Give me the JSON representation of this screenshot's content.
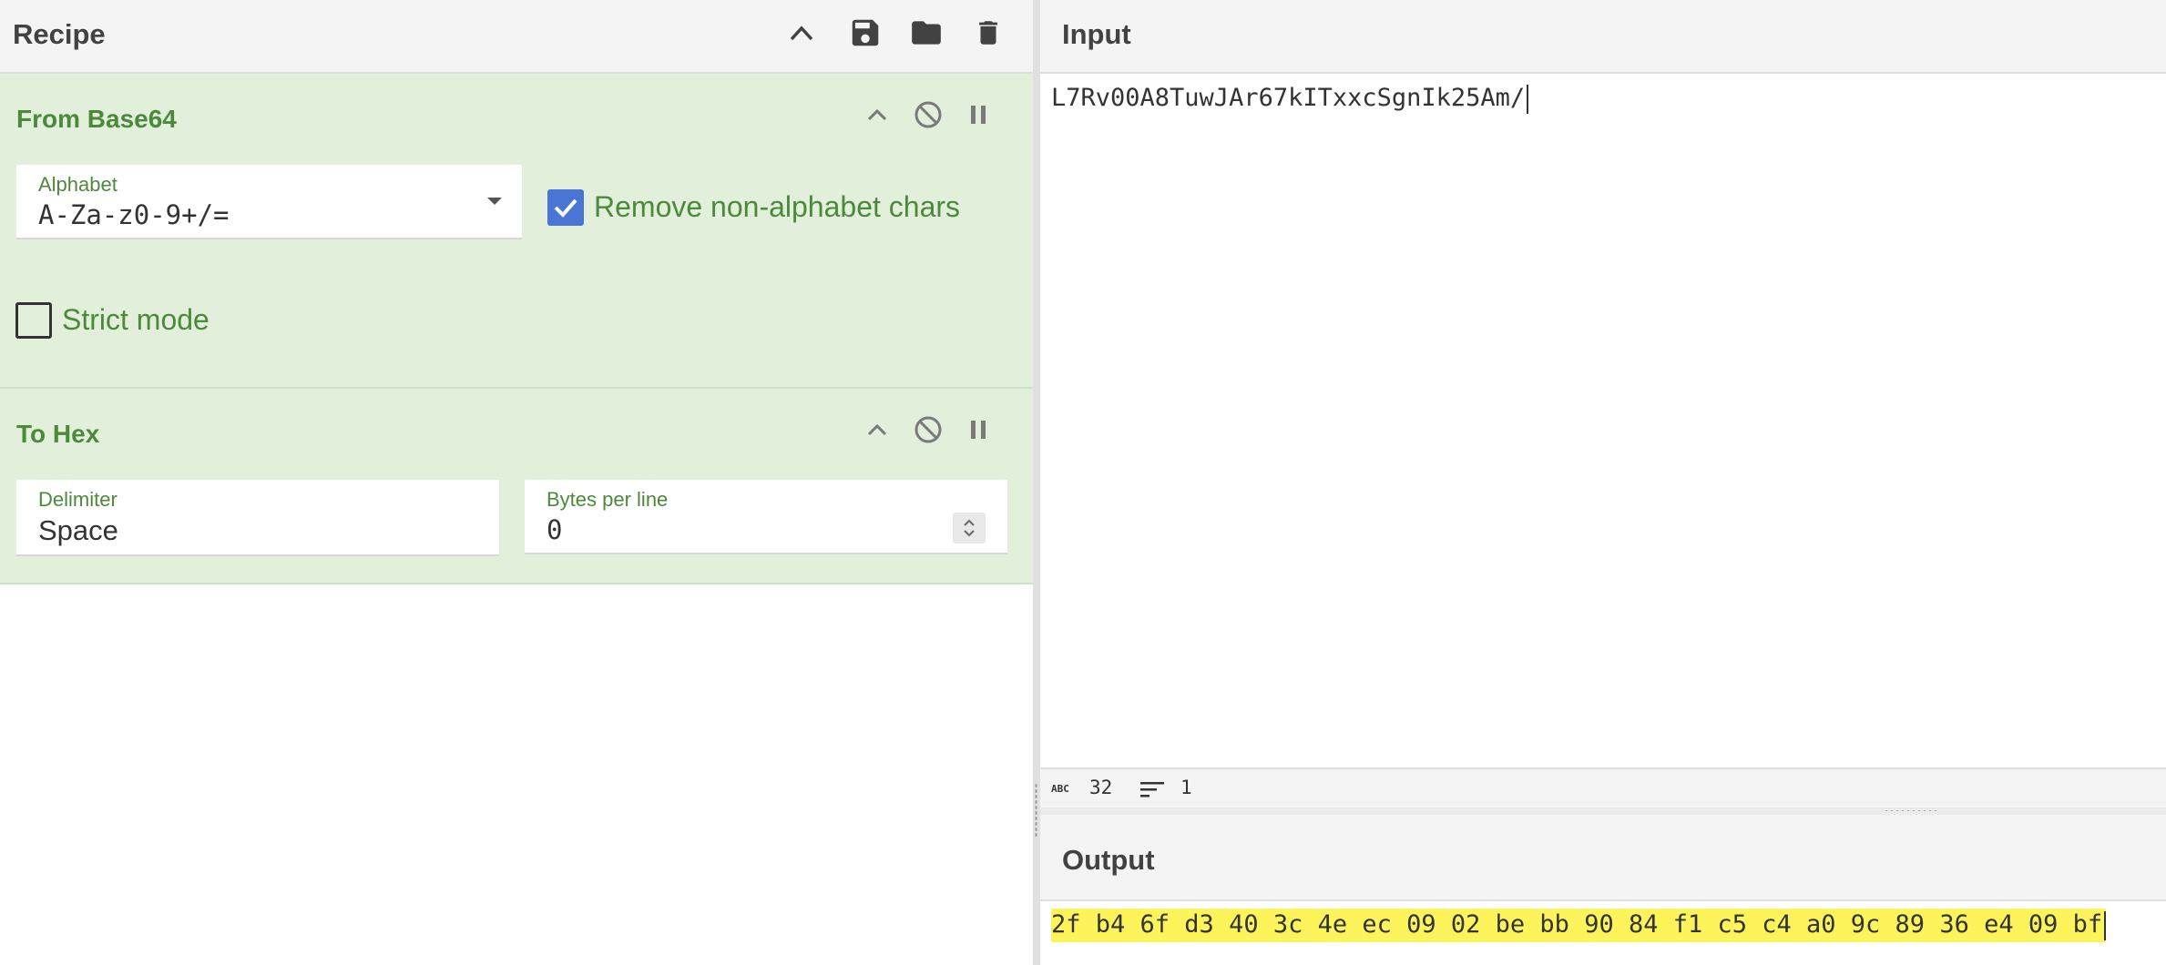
{
  "recipe": {
    "title": "Recipe",
    "operations": [
      {
        "title": "From Base64",
        "alphabet_label": "Alphabet",
        "alphabet_value": "A-Za-z0-9+/=",
        "remove_label": "Remove non-alphabet chars",
        "remove_checked": true,
        "strict_label": "Strict mode",
        "strict_checked": false
      },
      {
        "title": "To Hex",
        "delimiter_label": "Delimiter",
        "delimiter_value": "Space",
        "bytes_label": "Bytes per line",
        "bytes_value": "0"
      }
    ]
  },
  "input": {
    "title": "Input",
    "text": "L7Rv00A8TuwJAr67kITxxcSgnIk25Am/",
    "char_count": "32",
    "line_count": "1"
  },
  "output": {
    "title": "Output",
    "text": "2f b4 6f d3 40 3c 4e ec 09 02 be bb 90 84 f1 c5 c4 a0 9c 89 36 e4 09 bf"
  },
  "colors": {
    "operation_bg": "#e2efda",
    "operation_text": "#4c8a3b",
    "checkbox_checked": "#4a75d4",
    "output_highlight": "#fdf45c"
  }
}
